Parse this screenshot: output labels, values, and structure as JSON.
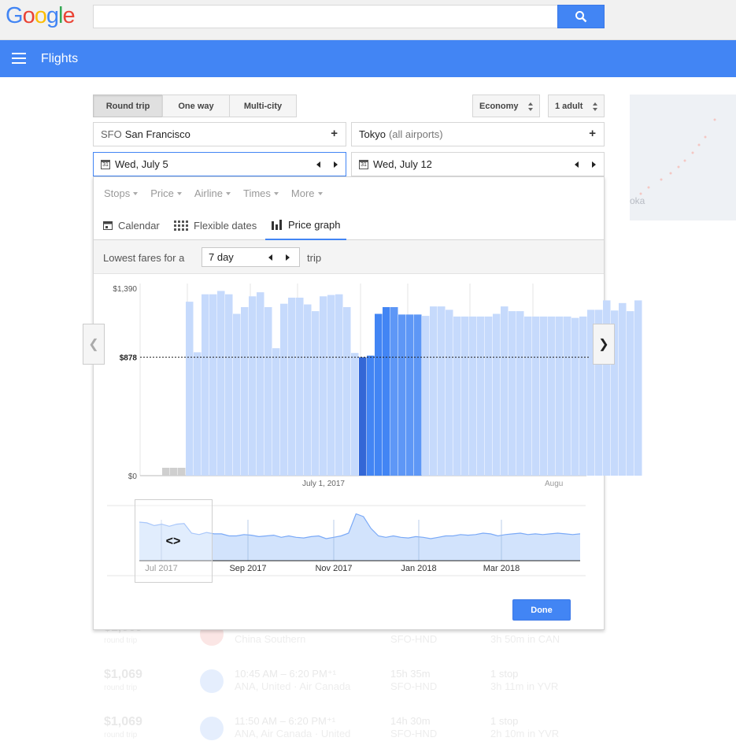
{
  "header": {
    "logo_letters": [
      "G",
      "o",
      "o",
      "g",
      "l",
      "e"
    ],
    "search_value": "",
    "app_title": "Flights",
    "icons": [
      "search-icon",
      "menu-icon"
    ]
  },
  "trip_types": [
    "Round trip",
    "One way",
    "Multi-city"
  ],
  "trip_type_selected": "Round trip",
  "cabin": "Economy",
  "passengers": "1 adult",
  "origin": {
    "code": "SFO",
    "name": "San Francisco"
  },
  "destination": {
    "name": "Tokyo",
    "sub": "(all airports)"
  },
  "depart_date": "Wed, July 5",
  "return_date": "Wed, July 12",
  "calendar_glyph": "31",
  "filters": [
    "Stops",
    "Price",
    "Airline",
    "Times",
    "More"
  ],
  "view_tabs": {
    "calendar": "Calendar",
    "flexible": "Flexible dates",
    "graph": "Price graph",
    "active": "Price graph"
  },
  "fares_bar": {
    "prefix": "Lowest fares for a",
    "duration": "7 day",
    "suffix": "trip"
  },
  "done_label": "Done",
  "map_label": "oka",
  "chart_data": {
    "type": "bar",
    "title": "",
    "ylabel": "",
    "ylim": [
      0,
      1390
    ],
    "y_ticks": [
      "$1,390",
      "$878",
      "$0"
    ],
    "reference_line": 878,
    "x_labels": [
      "July 1, 2017",
      "Augu"
    ],
    "values": [
      0,
      0,
      0,
      1290,
      915,
      1345,
      1345,
      1370,
      1345,
      1200,
      1250,
      1330,
      1360,
      1250,
      945,
      1275,
      1320,
      1320,
      1270,
      1220,
      1330,
      1340,
      1345,
      1250,
      910,
      878,
      890,
      1200,
      1250,
      1250,
      1195,
      1195,
      1195,
      1185,
      1255,
      1255,
      1230,
      1180,
      1180,
      1180,
      1180,
      1180,
      1200,
      1255,
      1220,
      1220,
      1180,
      1180,
      1180,
      1180,
      1180,
      1180,
      1170,
      1180,
      1230,
      1230,
      1300,
      1225,
      1280,
      1220,
      1300
    ],
    "highlight": {
      "selected_index": 25,
      "trip_start": 26,
      "trip_end": 32
    },
    "overview": {
      "type": "area",
      "x_labels": [
        "Jul 2017",
        "Sep 2017",
        "Nov 2017",
        "Jan 2018",
        "Mar 2018"
      ],
      "values": [
        980,
        975,
        955,
        965,
        950,
        965,
        970,
        900,
        890,
        905,
        895,
        895,
        880,
        880,
        890,
        885,
        875,
        880,
        885,
        870,
        880,
        870,
        865,
        875,
        880,
        860,
        870,
        880,
        900,
        1040,
        1020,
        935,
        880,
        870,
        880,
        870,
        865,
        875,
        870,
        860,
        870,
        880,
        880,
        890,
        885,
        890,
        900,
        895,
        880,
        890,
        895,
        900,
        890,
        895,
        890,
        895,
        900,
        895,
        890,
        895
      ]
    }
  },
  "results": [
    {
      "price": "$1,069",
      "rt": "round trip",
      "time": "",
      "airline": "China Southern",
      "duration": "",
      "route": "SFO-HND",
      "stops": "",
      "layover": "3h 50m in CAN"
    },
    {
      "price": "$1,069",
      "rt": "round trip",
      "time": "10:45 AM – 6:20 PM⁺¹",
      "airline": "ANA, United · Air Canada",
      "duration": "15h 35m",
      "route": "SFO-HND",
      "stops": "1 stop",
      "layover": "3h 11m in YVR"
    },
    {
      "price": "$1,069",
      "rt": "round trip",
      "time": "11:50 AM – 6:20 PM⁺¹",
      "airline": "ANA, Air Canada · United",
      "duration": "14h 30m",
      "route": "SFO-HND",
      "stops": "1 stop",
      "layover": "2h 10m in YVR"
    }
  ]
}
